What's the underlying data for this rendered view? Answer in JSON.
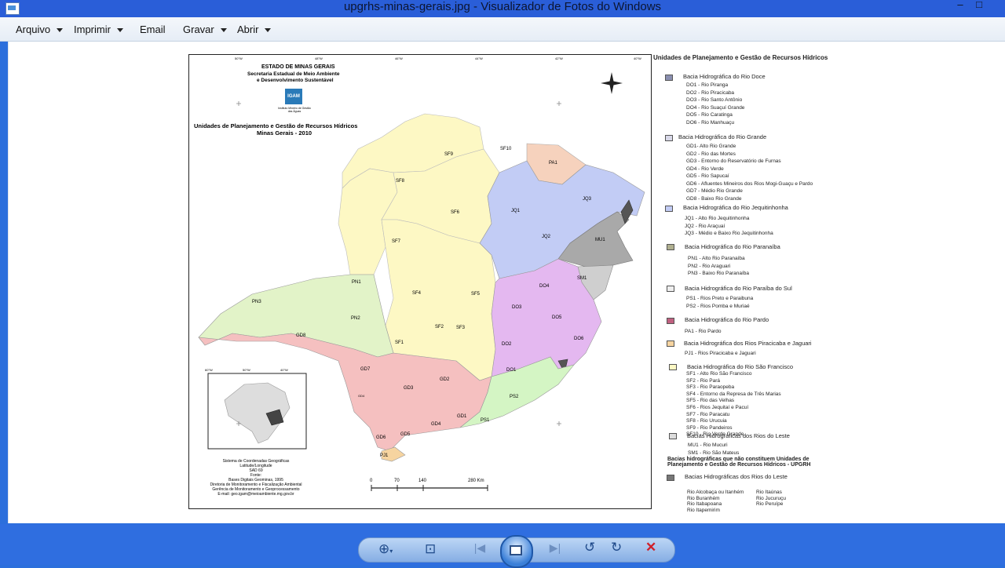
{
  "window": {
    "title": "upgrhs-minas-gerais.jpg - Visualizador de Fotos do Windows",
    "minimize": "–",
    "maximize": "□"
  },
  "menu": [
    {
      "label": "Arquivo",
      "dropdown": true
    },
    {
      "label": "Imprimir",
      "dropdown": true
    },
    {
      "label": "Email",
      "dropdown": false
    },
    {
      "label": "Gravar",
      "dropdown": true
    },
    {
      "label": "Abrir",
      "dropdown": true
    }
  ],
  "map": {
    "header": {
      "state": "ESTADO DE MINAS GERAIS",
      "secretariat_1": "Secretaria Estadual de Meio Ambiente",
      "secretariat_2": "e Desenvolvimento Sustentável",
      "logo": "IGAM",
      "logo_sub": "Instituto Mineiro de Gestão das Águas"
    },
    "title_1": "Unidades de Planejamento e Gestão de Recursos Hídricos",
    "title_2": "Minas Gerais - 2010",
    "regions": [
      {
        "code": "SF9",
        "color": "#fdf8c4"
      },
      {
        "code": "SF10",
        "color": "#fdf8c4"
      },
      {
        "code": "PA1",
        "color": "#f6d2bd"
      },
      {
        "code": "SF8",
        "color": "#fdf8c4"
      },
      {
        "code": "SF6",
        "color": "#fdf8c4"
      },
      {
        "code": "JQ1",
        "color": "#c2ccf5"
      },
      {
        "code": "JQ3",
        "color": "#c2ccf5"
      },
      {
        "code": "JQ2",
        "color": "#c2ccf5"
      },
      {
        "code": "MU1",
        "color": "#a9a9a9"
      },
      {
        "code": "SF7",
        "color": "#fdf8c4"
      },
      {
        "code": "SM1",
        "color": "#cfcfcf"
      },
      {
        "code": "PN1",
        "color": "#e2f3c8"
      },
      {
        "code": "DO4",
        "color": "#e4b8f0"
      },
      {
        "code": "PN3",
        "color": "#e2f3c8"
      },
      {
        "code": "SF4",
        "color": "#fdf8c4"
      },
      {
        "code": "SF5",
        "color": "#fdf8c4"
      },
      {
        "code": "DO3",
        "color": "#e4b8f0"
      },
      {
        "code": "DO5",
        "color": "#e4b8f0"
      },
      {
        "code": "PN2",
        "color": "#e2f3c8"
      },
      {
        "code": "SF2",
        "color": "#fdf8c4"
      },
      {
        "code": "SF3",
        "color": "#fdf8c4"
      },
      {
        "code": "GD8",
        "color": "#f5c0c0"
      },
      {
        "code": "DO6",
        "color": "#e4b8f0"
      },
      {
        "code": "SF1",
        "color": "#fdf8c4"
      },
      {
        "code": "DO2",
        "color": "#e4b8f0"
      },
      {
        "code": "GD7",
        "color": "#f5c0c0"
      },
      {
        "code": "DO1",
        "color": "#e4b8f0"
      },
      {
        "code": "GD3",
        "color": "#f5c0c0"
      },
      {
        "code": "GD2",
        "color": "#f5c0c0"
      },
      {
        "code": "PS2",
        "color": "#d4f5c4"
      },
      {
        "code": "GD4",
        "color": "#f5c0c0"
      },
      {
        "code": "GD1",
        "color": "#f5c0c0"
      },
      {
        "code": "PS1",
        "color": "#d4f5c4"
      },
      {
        "code": "GD6",
        "color": "#f5c0c0"
      },
      {
        "code": "GD5",
        "color": "#f5c0c0"
      },
      {
        "code": "PJ1",
        "color": "#f6d4a0"
      },
      {
        "code": "GD4",
        "color": "#f5c0c0"
      }
    ],
    "coord_system": [
      "Sistema de Coordenadas Geográficas",
      "Latitude/Longitude",
      "SAD 69"
    ],
    "source_label": "Fonte:",
    "source": [
      "Bases Digitais Geominas, 1995",
      "Diretoria de Monitoramento e Fiscalização Ambiental",
      "Gerência de Monitoramento e Geoprocessamento",
      "E-mail: geo.igam@meioambiente.mg.gov.br"
    ],
    "scale": [
      "0",
      "70",
      "140",
      "280 Km"
    ],
    "top_ticks": [
      "50°W",
      "48°W",
      "46°W",
      "44°W",
      "42°W",
      "40°W"
    ],
    "inset_ticks": [
      "60°W",
      "50°W",
      "40°W"
    ]
  },
  "legend": {
    "title": "Unidades de Planejamento e Gestão de Recursos Hídricos",
    "groups": [
      {
        "name": "Bacia Hidrográfica do Rio Doce",
        "color": "#8a8fb0",
        "items": [
          "DO1 - Rio Piranga",
          "DO2 - Rio Piracicaba",
          "DO3 - Rio Santo Antônio",
          "DO4 - Rio Suaçuí Grande",
          "DO5 - Rio Caratinga",
          "DO6 - Rio Manhuaçu"
        ]
      },
      {
        "name": "Bacia Hidrográfica do Rio Grande",
        "color": "#d8d8e8",
        "items": [
          "GD1- Alto Rio Grande",
          "GD2 - Rio das Mortes",
          "GD3 - Entorno do Reservatório de Furnas",
          "GD4 - Rio Verde",
          "GD5 - Rio Sapucaí",
          "GD6 - Afluentes Mineiros dos Rios Mogi-Guaçu e Pardo",
          "GD7 - Médio Rio Grande",
          "GD8 - Baixo Rio Grande"
        ]
      },
      {
        "name": "Bacia Hidrográfica do Rio Jequitinhonha",
        "color": "#c2ccf5",
        "items": [
          "JQ1 - Alto Rio Jequitinhonha",
          "JQ2 - Rio Araçuaí",
          "JQ3 - Médio e Baixo Rio Jequitinhonha"
        ]
      },
      {
        "name": "Bacia Hidrográfica do Rio Paranaíba",
        "color": "#b0b090",
        "items": [
          "PN1 - Alto Rio Paranaíba",
          "PN2 - Rio Araguari",
          "PN3 - Baixo Rio Paranaíba"
        ]
      },
      {
        "name": "Bacia Hidrográfica do Rio Paraíba do Sul",
        "color": "#eeeeee",
        "items": [
          "PS1 - Rios Preto e Paraibuna",
          "PS2 - Rios Pomba e Muriaé"
        ]
      },
      {
        "name": "Bacia Hidrográfica do Rio Pardo",
        "color": "#c06080",
        "items": [
          "PA1 - Rio Pardo"
        ]
      },
      {
        "name": "Bacia Hidrográfica dos Rios Piracicaba e Jaguari",
        "color": "#f6d4a0",
        "items": [
          "PJ1 - Rios Piracicaba e Jaguari"
        ]
      },
      {
        "name": "Bacia Hidrográfica do Rio São Francisco",
        "color": "#fdf8c4",
        "items": [
          "SF1 - Alto Rio São Francisco",
          "SF2 - Rio Pará",
          "SF3 - Rio Paraopeba",
          "SF4 - Entorno da Represa de Três Marias",
          "SF5 - Rio das Velhas",
          "SF6 - Rios Jequitaí e Pacuí",
          "SF7 - Rio Paracatu",
          "SF8 - Rio Urucuia",
          "SF9 - Rio Pandeiros",
          "SF10 - Rio Verde Grande"
        ]
      },
      {
        "name": "Bacias Hidrográficas dos Rios do Leste",
        "color": "#dddddd",
        "items": [
          "MU1 - Rio Mucuri",
          "SM1 - Rio São Mateus"
        ]
      }
    ],
    "non_upgrh_title_1": "Bacias hidrográficas que não constituem Unidades de",
    "non_upgrh_title_2": "Planejamento e Gestão de Recursos Hídricos - UPGRH",
    "non_upgrh_group": "Bacias Hidrográficas dos Rios do Leste",
    "non_upgrh_color": "#777777",
    "rivers_col1": [
      "Rio Alcobaça ou Itanhém",
      "Rio Buranhém",
      "Rio Itabapoana",
      "Rio Itapemirim"
    ],
    "rivers_col2": [
      "Rio Itaúnas",
      "Rio Jucuruçu",
      "Rio Peruípe"
    ]
  },
  "toolbar": {
    "zoom": "zoom-icon",
    "fit": "actual-size-icon",
    "prev": "previous-icon",
    "slideshow": "slideshow-icon",
    "next": "next-icon",
    "rotate_left": "rotate-left-icon",
    "rotate_right": "rotate-right-icon",
    "delete": "delete-icon"
  }
}
